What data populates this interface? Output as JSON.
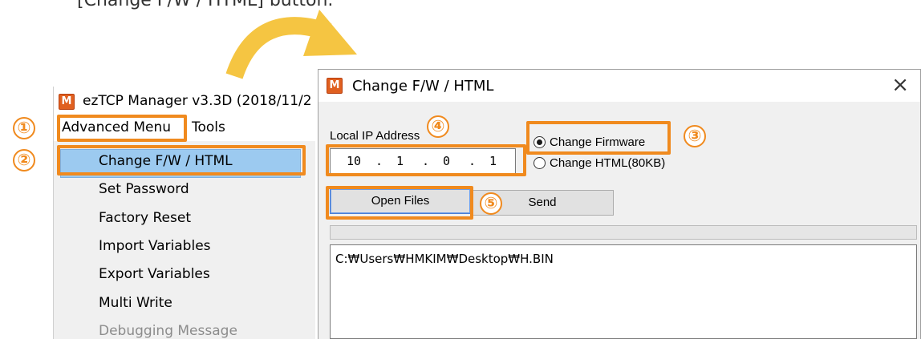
{
  "caption": "[Change F/W / HTML] button.",
  "left_window": {
    "title": "ezTCP Manager v3.3D (2018/11/2",
    "menu": {
      "advanced": "Advanced Menu",
      "tools": "Tools"
    },
    "dropdown": [
      {
        "label": "Change F/W / HTML",
        "highlighted": true
      },
      {
        "label": "Set Password"
      },
      {
        "label": "Factory Reset"
      },
      {
        "label": "Import Variables"
      },
      {
        "label": "Export Variables"
      },
      {
        "label": "Multi Write"
      },
      {
        "label": "Debugging Message",
        "disabled": true
      }
    ]
  },
  "dialog": {
    "title": "Change F/W / HTML",
    "close": "×",
    "ip_label": "Local IP Address",
    "ip": [
      "10",
      "1",
      "0",
      "1"
    ],
    "ip_sep": ".",
    "radio_firmware": "Change Firmware",
    "radio_html": "Change HTML(80KB)",
    "radio_selected": "firmware",
    "open_button": "Open Files",
    "send_button": "Send",
    "path": "C:₩Users₩HMKIM₩Desktop₩H.BIN"
  },
  "callouts": [
    "①",
    "②",
    "③",
    "④",
    "⑤"
  ],
  "icon_letter": "M",
  "colors": {
    "callout": "#f08a1e",
    "arrow": "#f5c542",
    "highlight": "#9ccaf0"
  }
}
